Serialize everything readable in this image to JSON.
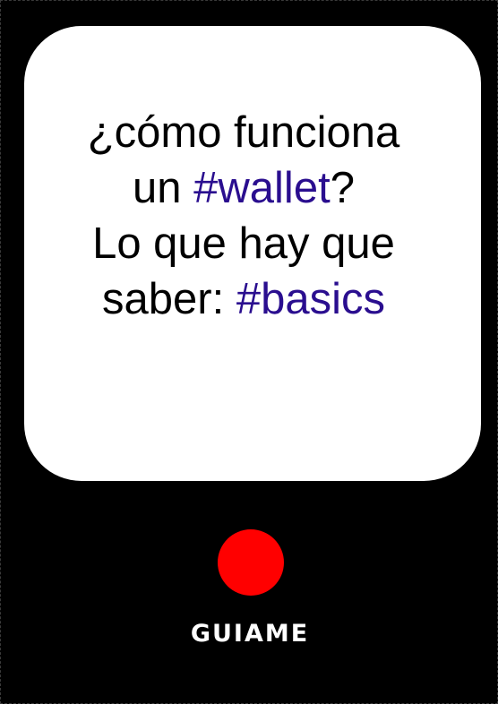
{
  "card": {
    "line1": "¿cómo funciona",
    "line2_prefix": "un ",
    "line2_tag": "#wallet",
    "line2_suffix": "?",
    "line3": "Lo que hay que",
    "line4_prefix": "saber: ",
    "line4_tag": "#basics"
  },
  "action": {
    "label": "GUIAME"
  },
  "colors": {
    "background": "#000000",
    "card": "#ffffff",
    "hashtag": "#2a0e8f",
    "button": "#ff0000",
    "label": "#ffffff"
  },
  "icons": {
    "button": "red-circle"
  }
}
